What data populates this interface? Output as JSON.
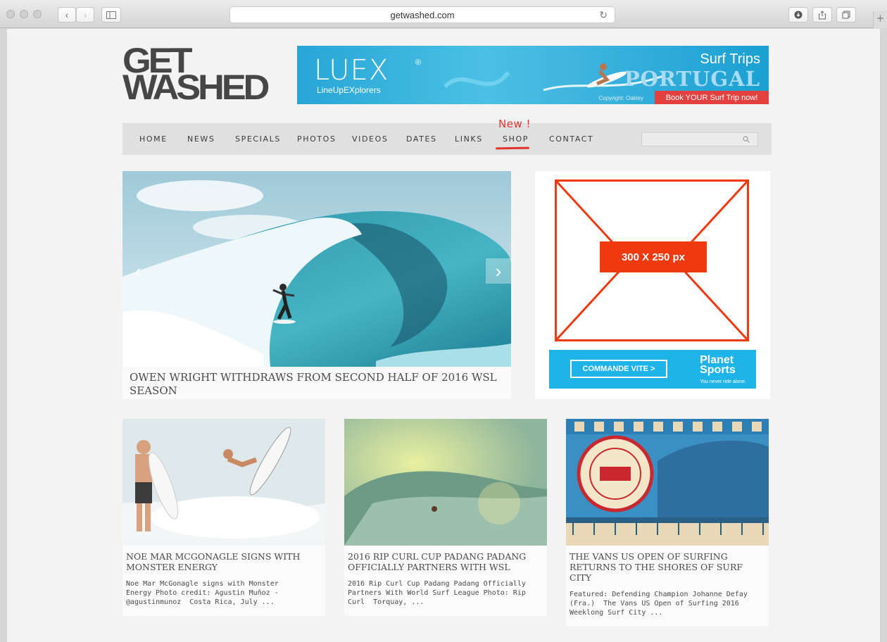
{
  "browser": {
    "url": "getwashed.com",
    "reload_icon": "reload-icon",
    "plus": "+"
  },
  "site": {
    "logo_line1": "GET",
    "logo_line2": "WASHED"
  },
  "banner": {
    "brand": "LUEX",
    "brand_sub": "LineUpEXplorers",
    "registered": "®",
    "tagline": "Surf Trips",
    "destination": "PORTUGAL",
    "cta": "Book YOUR Surf Trip now!",
    "credit": "Copyright: Oakley"
  },
  "nav": {
    "items": [
      "HOME",
      "NEWS",
      "SPECIALS",
      "PHOTOS",
      "VIDEOS",
      "DATES",
      "LINKS",
      "SHOP",
      "CONTACT"
    ],
    "new_badge": "New !",
    "search_placeholder": ""
  },
  "featured": {
    "caption": "OWEN WRIGHT WITHDRAWS FROM SECOND HALF OF 2016 WSL SEASON",
    "prev": "‹",
    "next": "›"
  },
  "ad": {
    "size_label": "300 X 250 px",
    "cta": "COMMANDE VITE >",
    "brand_line1": "Planet",
    "brand_line2": "Sports",
    "brand_tagline": "You never ride alone."
  },
  "cards": [
    {
      "title": "NOE MAR MCGONAGLE SIGNS WITH MONSTER ENERGY",
      "excerpt": "Noe Mar McGonagle signs with Monster\nEnergy Photo credit: Agustin Muñoz -\n@agustinmunoz  Costa Rica, July ..."
    },
    {
      "title": "2016 RIP CURL CUP PADANG PADANG OFFICIALLY PARTNERS WITH WSL",
      "excerpt": "2016 Rip Curl Cup Padang Padang Officially\nPartners With World Surf League Photo: Rip\nCurl  Torquay, ..."
    },
    {
      "title": "THE VANS US OPEN OF SURFING RETURNS TO THE SHORES OF SURF CITY",
      "excerpt": "Featured: Defending Champion Johanne Defay\n(Fra.)  The Vans US Open of Surfing 2016\nWeeklong Surf City ..."
    }
  ],
  "colors": {
    "accent_red": "#e3352e",
    "ad_orange": "#f1390f",
    "banner_blue": "#27a6d6"
  }
}
